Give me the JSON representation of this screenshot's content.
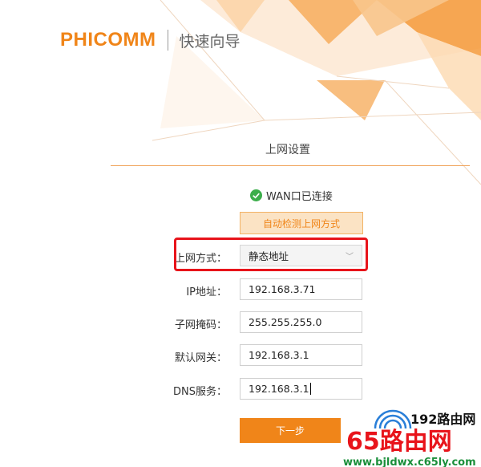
{
  "header": {
    "logo": "PHICOMM",
    "subtitle": "快速向导"
  },
  "section": {
    "title": "上网设置"
  },
  "status": {
    "text": "WAN口已连接"
  },
  "auto_detect_button": "自动检测上网方式",
  "form": {
    "connection_type": {
      "label": "上网方式：",
      "value": "静态地址"
    },
    "ip": {
      "label": "IP地址：",
      "value": "192.168.3.71"
    },
    "subnet": {
      "label": "子网掩码：",
      "value": "255.255.255.0"
    },
    "gateway": {
      "label": "默认网关：",
      "value": "192.168.3.1"
    },
    "dns": {
      "label": "DNS服务：",
      "value": "192.168.3.1"
    }
  },
  "next_button": "下一步",
  "watermark": {
    "top": "192路由网",
    "main": "65路由网",
    "url": "www.bjldwx.c65ly.com"
  },
  "colors": {
    "accent": "#f08519",
    "highlight": "#e8141b",
    "success": "#3cae4b"
  }
}
